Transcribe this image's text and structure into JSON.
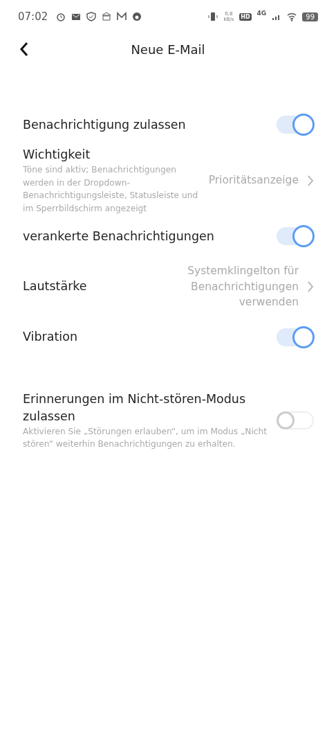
{
  "status_bar": {
    "time": "07:02",
    "speed_value": "0,8",
    "speed_unit": "kB/s",
    "hd": "HD",
    "network": "4G",
    "battery": "99"
  },
  "header": {
    "title": "Neue E-Mail"
  },
  "settings": [
    {
      "kind": "toggle",
      "label": "Benachrichtigung zulassen",
      "on": true
    },
    {
      "kind": "detail",
      "label": "Wichtigkeit",
      "description": "Töne sind aktiv; Benachrichtigungen werden in der Dropdown-Benachrichtigungsleiste, Statusleiste und im Sperrbildschirm angezeigt",
      "value": "Prioritätsanzeige"
    },
    {
      "kind": "toggle",
      "label": "verankerte Benachrichtigungen",
      "on": true
    },
    {
      "kind": "detail",
      "label": "Lautstärke",
      "value": "Systemklingelton für Benachrichtigungen verwenden"
    },
    {
      "kind": "toggle",
      "label": "Vibration",
      "on": true
    }
  ],
  "do_not_disturb": [
    {
      "kind": "toggle",
      "label": "Erinnerungen im Nicht-stören-Modus zulassen",
      "description": "Aktivieren Sie „Störungen erlauben“, um im Modus „Nicht stören“ weiterhin Benachrichtigungen zu erhalten.",
      "on": false
    }
  ]
}
